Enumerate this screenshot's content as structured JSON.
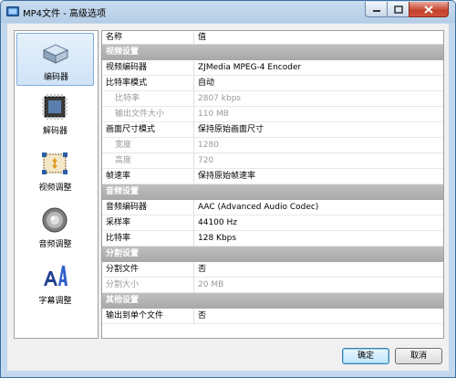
{
  "window": {
    "title": "MP4文件 - 高级选项"
  },
  "colors": {
    "selected_bg": "#cfe3f7",
    "category_bg": "#b3b3b3",
    "close_red": "#c4402b",
    "frame": "#b4cde6"
  },
  "nav": {
    "items": [
      {
        "label": "编码器",
        "icon": "encoder-icon",
        "selected": true
      },
      {
        "label": "解码器",
        "icon": "decoder-icon",
        "selected": false
      },
      {
        "label": "视频调整",
        "icon": "video-adjust-icon",
        "selected": false
      },
      {
        "label": "音频调整",
        "icon": "audio-adjust-icon",
        "selected": false
      },
      {
        "label": "字幕调整",
        "icon": "subtitle-icon",
        "selected": false
      }
    ]
  },
  "grid": {
    "header": {
      "name": "名称",
      "value": "值"
    },
    "rows": [
      {
        "kind": "category",
        "label": "视频设置"
      },
      {
        "kind": "prop",
        "label": "视频编码器",
        "value": "ZJMedia MPEG-4 Encoder"
      },
      {
        "kind": "prop",
        "label": "比特率模式",
        "value": "自动"
      },
      {
        "kind": "sub-disabled",
        "label": "比特率",
        "value": "2807 kbps"
      },
      {
        "kind": "sub-disabled",
        "label": "输出文件大小",
        "value": "110 MB"
      },
      {
        "kind": "prop",
        "label": "画面尺寸模式",
        "value": "保持原始画面尺寸"
      },
      {
        "kind": "sub-disabled",
        "label": "宽度",
        "value": "1280"
      },
      {
        "kind": "sub-disabled",
        "label": "高度",
        "value": "720"
      },
      {
        "kind": "prop",
        "label": "帧速率",
        "value": "保持原始帧速率"
      },
      {
        "kind": "category",
        "label": "音频设置"
      },
      {
        "kind": "prop",
        "label": "音频编码器",
        "value": "AAC (Advanced Audio Codec)"
      },
      {
        "kind": "prop",
        "label": "采样率",
        "value": "44100 Hz"
      },
      {
        "kind": "prop",
        "label": "比特率",
        "value": "128 Kbps"
      },
      {
        "kind": "category",
        "label": "分割设置"
      },
      {
        "kind": "prop",
        "label": "分割文件",
        "value": "否"
      },
      {
        "kind": "disabled",
        "label": "分割大小",
        "value": "20 MB"
      },
      {
        "kind": "category",
        "label": "其他设置"
      },
      {
        "kind": "prop",
        "label": "输出到单个文件",
        "value": "否"
      }
    ]
  },
  "buttons": {
    "ok": "确定",
    "cancel": "取消"
  }
}
